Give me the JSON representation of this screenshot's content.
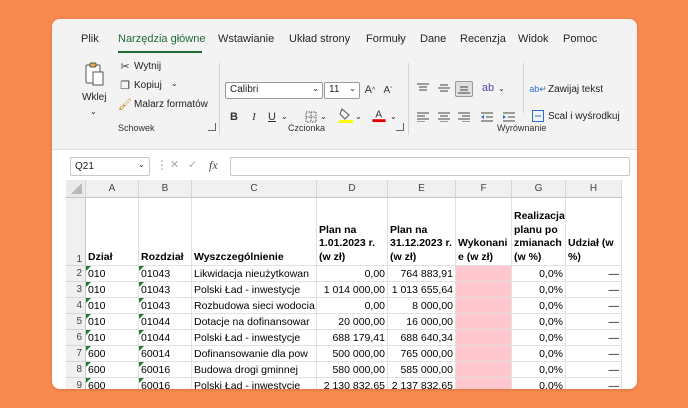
{
  "tabs": [
    "Plik",
    "Narzędzia główne",
    "Wstawianie",
    "Układ strony",
    "Formuły",
    "Dane",
    "Recenzja",
    "Widok",
    "Pomoc"
  ],
  "ribbon": {
    "paste": "Wklej",
    "cut": "Wytnij",
    "copy": "Kopiuj",
    "painter": "Malarz formatów",
    "clipboard_group": "Schowek",
    "font_name": "Calibri",
    "font_size": "11",
    "font_group": "Czcionka",
    "wrap_text": "Zawijaj tekst",
    "merge_center": "Scal i wyśrodkuj",
    "align_group": "Wyrównanie",
    "grow_font": "A^",
    "shrink_font": "Aˇ",
    "bold": "B",
    "italic": "I",
    "underline": "U"
  },
  "formula_bar": {
    "cell_ref": "Q21",
    "fx": "fx",
    "cancel": "✕",
    "enter": "✓",
    "value": ""
  },
  "columns": [
    "A",
    "B",
    "C",
    "D",
    "E",
    "F",
    "G",
    "H"
  ],
  "header_row": {
    "num": "1",
    "cells": [
      "Dział",
      "Rozdział",
      "Wyszczególnienie",
      "Plan na 1.01.2023 r. (w zł)",
      "Plan na 31.12.2023 r. (w zł)",
      "Wykonanie (w zł)",
      "Realizacja planu po zmianach (w %)",
      "Udział (w %)"
    ]
  },
  "rows": [
    {
      "num": "2",
      "a": "010",
      "b": "01043",
      "c": "Likwidacja nieużytkowan",
      "d": "0,00",
      "e": "764 883,91",
      "f": "",
      "g": "0,0%",
      "h": "—"
    },
    {
      "num": "3",
      "a": "010",
      "b": "01043",
      "c": "Polski Ład - inwestycje",
      "d": "1 014 000,00",
      "e": "1 013 655,64",
      "f": "",
      "g": "0,0%",
      "h": "—"
    },
    {
      "num": "4",
      "a": "010",
      "b": "01043",
      "c": "Rozbudowa sieci wodocia",
      "d": "0,00",
      "e": "8 000,00",
      "f": "",
      "g": "0,0%",
      "h": "—"
    },
    {
      "num": "5",
      "a": "010",
      "b": "01044",
      "c": "Dotacje na dofinansowar",
      "d": "20 000,00",
      "e": "16 000,00",
      "f": "",
      "g": "0,0%",
      "h": "—"
    },
    {
      "num": "6",
      "a": "010",
      "b": "01044",
      "c": "Polski Ład - inwestycje",
      "d": "688 179,41",
      "e": "688 640,34",
      "f": "",
      "g": "0,0%",
      "h": "—"
    },
    {
      "num": "7",
      "a": "600",
      "b": "60014",
      "c": "Dofinansowanie dla pow",
      "d": "500 000,00",
      "e": "765 000,00",
      "f": "",
      "g": "0,0%",
      "h": "—"
    },
    {
      "num": "8",
      "a": "600",
      "b": "60016",
      "c": "Budowa drogi gminnej",
      "d": "580 000,00",
      "e": "585 000,00",
      "f": "",
      "g": "0,0%",
      "h": "—"
    },
    {
      "num": "9",
      "a": "600",
      "b": "60016",
      "c": "Polski Ład - inwestycje",
      "d": "2 130 832,65",
      "e": "2 137 832,65",
      "f": "",
      "g": "0,0%",
      "h": "—"
    }
  ],
  "colors": {
    "accent": "#1e6b39",
    "pink_fill": "#ffc7ce",
    "background": "#f98a4f"
  }
}
